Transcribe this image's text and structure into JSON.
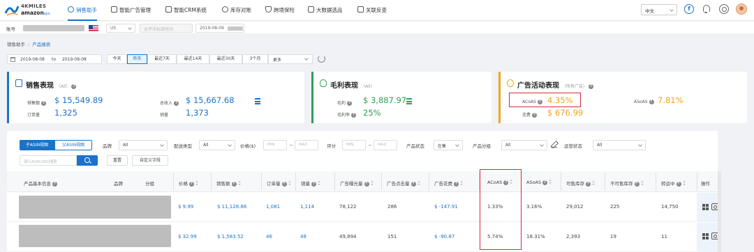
{
  "app": {
    "logo_line1": "4KMILES",
    "logo_line2": "amazon",
    "logo_suffix": "spn"
  },
  "nav": [
    {
      "label": "销售助手",
      "active": true,
      "icon": "assistant-icon"
    },
    {
      "label": "智能广告管理",
      "active": false,
      "icon": "ad-icon"
    },
    {
      "label": "智能CRM系统",
      "active": false,
      "icon": "mail-icon"
    },
    {
      "label": "库存对账",
      "active": false,
      "icon": "inventory-icon"
    },
    {
      "label": "跨境保险",
      "active": false,
      "icon": "shield-icon"
    },
    {
      "label": "大数据选品",
      "active": false,
      "icon": "data-icon"
    },
    {
      "label": "关联反查",
      "active": false,
      "icon": "link-icon"
    }
  ],
  "header": {
    "language": "中文",
    "facebook_glyph": "f"
  },
  "account_bar": {
    "label": "账号",
    "country": "US",
    "timezone_placeholder": "太平洋标准时间",
    "date": "2019-08-09"
  },
  "breadcrumb": {
    "root": "销售助手",
    "separator": "/",
    "current": "产品报表"
  },
  "date_filter": {
    "start": "2019-08-08",
    "to": "to",
    "end": "2019-08-08",
    "quick": [
      "今天",
      "昨天",
      "最近7天",
      "最近14天",
      "最近30天",
      "3个月"
    ],
    "active_index": 1,
    "more": "更多"
  },
  "cards": {
    "sales": {
      "title": "销售表现",
      "scope": "（All）",
      "sales_label": "销售额",
      "sales_value": "$ 15,549.89",
      "revenue_label": "总收入",
      "revenue_value": "$ 15,667.68",
      "orders_label": "订单量",
      "orders_value": "1,325",
      "units_label": "销量",
      "units_value": "1,373"
    },
    "profit": {
      "title": "毛利表现",
      "scope": "（All）",
      "gross_label": "毛利",
      "gross_value": "$ 3,887.97",
      "margin_label": "毛利率",
      "margin_value": "25%"
    },
    "ads": {
      "title": "广告活动表现",
      "scope": "（所有广告）",
      "acos_label": "ACoAS",
      "acos_value": "4.35%",
      "asoas_label": "ASoAS",
      "asoas_value": "7.81%",
      "spend_label": "花费",
      "spend_value": "$ 676.99"
    }
  },
  "filters": {
    "view_child": "子ASIN视图",
    "view_parent": "父ASIN视图",
    "brand_label": "品牌",
    "brand_value": "All",
    "ship_label": "配送类型",
    "ship_value": "All",
    "price_label": "价格($)",
    "min": "MIN",
    "max": "MAX",
    "rating_label": "评分",
    "status_label": "产品状态",
    "status_value": "在售",
    "group_label": "产品分组",
    "group_value": "All",
    "op_label": "运营状态",
    "op_value": "All",
    "search_placeholder": "请以ASIN,SKU搜索",
    "reset": "重置",
    "custom_fields": "自定义字段"
  },
  "table": {
    "columns": [
      "产品基本信息",
      "品牌",
      "分组",
      "价格",
      "销售额",
      "订单量",
      "销量",
      "广告曝光量",
      "广告点击量",
      "广告花费",
      "ACoAS",
      "ASoAS",
      "可售库存",
      "不可售库存",
      "转运中",
      "操作"
    ],
    "rows": [
      {
        "price": "$ 9.99",
        "sales": "$ 11,128.86",
        "orders": "1,081",
        "units": "1,114",
        "impressions": "78,122",
        "clicks": "286",
        "spend": "$ -147.91",
        "acoas": "1.33%",
        "asoas": "3.16%",
        "sellable": "29,012",
        "unsellable": "225",
        "inbound": "14,750"
      },
      {
        "price": "$ 32.99",
        "sales": "$ 1,583.52",
        "orders": "46",
        "units": "48",
        "impressions": "49,894",
        "clicks": "151",
        "spend": "$ -90.87",
        "acoas": "5.74%",
        "asoas": "18.31%",
        "sellable": "2,393",
        "unsellable": "19",
        "inbound": "11"
      }
    ]
  },
  "colors": {
    "accent": "#1a73c7",
    "sales_value": "#1a73c7",
    "profit_value": "#2e9e55",
    "ads_value": "#f2a516",
    "highlight": "#d8283d"
  }
}
